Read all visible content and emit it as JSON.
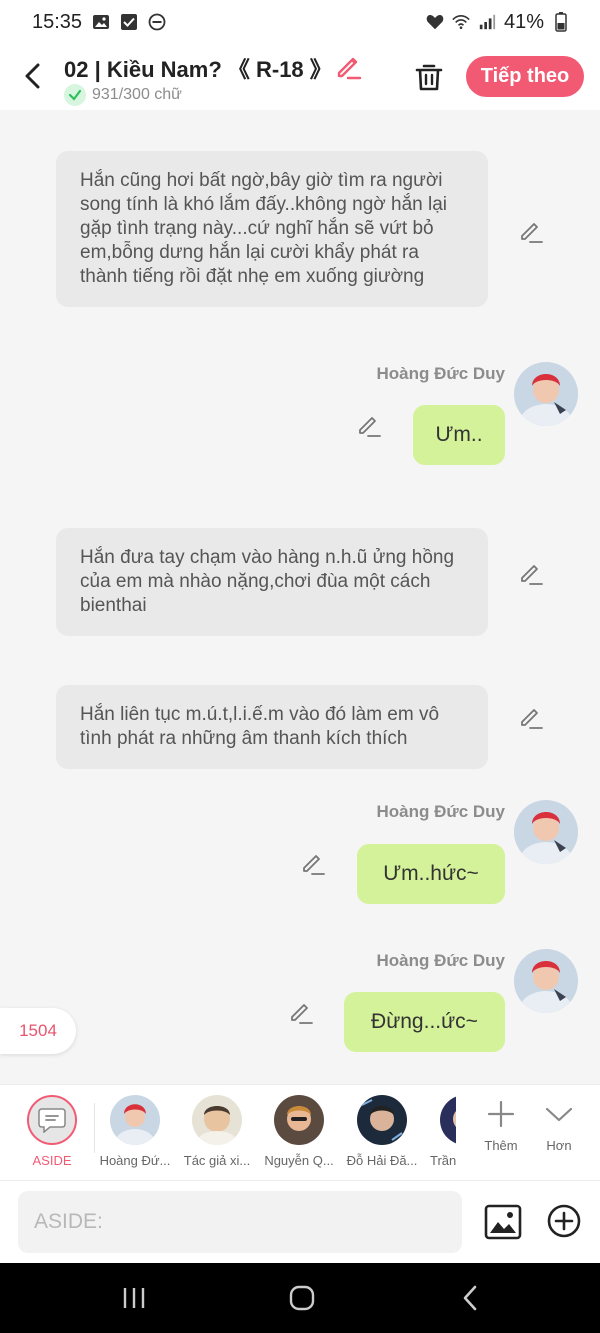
{
  "status_bar": {
    "time": "15:35",
    "battery": "41%"
  },
  "header": {
    "title": "02 | Kiều Nam? 《 R-18 》",
    "word_count": "931/300 chữ",
    "next_label": "Tiếp theo"
  },
  "messages": [
    {
      "type": "narration",
      "text": "Hắn cũng hơi bất ngờ,bây giờ tìm ra người song tính là khó lắm đấy..không ngờ hắn lại gặp tình trạng này...cứ nghĩ hắn sẽ vứt bỏ em,bỗng dưng hắn lại cười khẩy phát ra thành tiếng rồi đặt nhẹ em xuống giường"
    },
    {
      "type": "dialogue",
      "sender": "Hoàng Đức Duy",
      "text": "Ưm.."
    },
    {
      "type": "narration",
      "text": "Hắn đưa tay chạm vào hàng n.h.ũ ửng hồng của em mà nhào nặng,chơi đùa một cách bienthai"
    },
    {
      "type": "narration",
      "text": "Hắn liên tục m.ú.t,l.i.ế.m vào đó làm em vô tình phát ra những âm thanh kích thích"
    },
    {
      "type": "dialogue",
      "sender": "Hoàng Đức Duy",
      "text": "Ưm..hức~"
    },
    {
      "type": "dialogue",
      "sender": "Hoàng Đức Duy",
      "text": "Đừng...ức~"
    }
  ],
  "counter": "1504",
  "characters": [
    {
      "name": "ASIDE"
    },
    {
      "name": "Hoàng Đứ..."
    },
    {
      "name": "Tác giả xi..."
    },
    {
      "name": "Nguyễn Q..."
    },
    {
      "name": "Đỗ Hải Đă..."
    },
    {
      "name": "Trần"
    }
  ],
  "tools": {
    "add_label": "Thêm",
    "more_label": "Hơn"
  },
  "input": {
    "placeholder": "ASIDE:"
  },
  "colors": {
    "accent": "#f25a74",
    "dialogue_bubble": "#d4f29a",
    "narration_bg": "#e9e9e9"
  }
}
